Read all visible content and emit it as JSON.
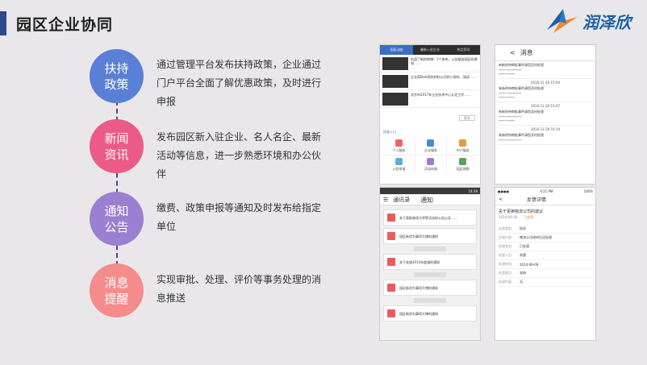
{
  "header": {
    "title": "园区企业协同"
  },
  "logo": {
    "text": "润泽欣",
    "colors": [
      "#1a5fa6",
      "#ec8c2d"
    ]
  },
  "colors": {
    "accent": "#2e4a8c",
    "c1": "#5a7fd6",
    "c2": "#ec5b87",
    "c3": "#9b7fd0",
    "c4": "#f48c8c"
  },
  "features": [
    {
      "title": "扶持\n政策",
      "desc": "通过管理平台发布扶持政策，企业通过门户平台全面了解优惠政策，及时进行申报"
    },
    {
      "title": "新闻\n资讯",
      "desc": "发布园区新入驻企业、名人名企、最新活动等信息，进一步熟悉环境和办公伙伴"
    },
    {
      "title": "通知\n公告",
      "desc": "缴费、政策申报等通知及时发布给指定单位"
    },
    {
      "title": "消息\n提醒",
      "desc": "实现审批、处理、评价等事务处理的消息推送"
    }
  ],
  "screen1": {
    "tabs": [
      "园区动态",
      "最新入驻企业",
      "热点资讯"
    ],
    "news": [
      "巩固了新的商铺！1个来申，公告服务园区的通知……",
      "企业家Bset家的材料公司的二周年，阅读……",
      "北京市2017年企业技术中心认定工作……"
    ],
    "more": "更多",
    "section": "快速入口",
    "grid": [
      "个人服务",
      "企业服务",
      "中介服务",
      "入驻申请",
      "活动申请",
      "园区地图"
    ]
  },
  "screen2": {
    "back": "<",
    "title": "消息",
    "messages": [
      {
        "title": "有新的待审批事件请您及时处理",
        "date": ""
      },
      {
        "title": "有新的待审批事件请您及时处理",
        "date": "2016-11-29 15:00"
      },
      {
        "title": "有新的待审批事件请您及时处理",
        "date": "2016-11-29 14:47"
      },
      {
        "title": "有新的待审批事件请您及时处理",
        "date": "2016-11-29 16:19"
      }
    ]
  },
  "screen3": {
    "status_right": "14:39",
    "title": "通讯录",
    "tab": "通知",
    "notices": [
      "关于表彰继续大师等活动的公告以及……",
      "园区新尚为事项大博的通知",
      "关于发放2014年度通的通知",
      "园区新尚为事项大博的通知",
      "园区新尚为事项大博的通知"
    ]
  },
  "screen4": {
    "status_left": "●●●●",
    "status_mid": "4:21 PM",
    "status_right": "100%",
    "back": "<",
    "title": "反馈详情",
    "fb_title": "关于更换物流公司的建议",
    "fb_date": "2014-09-30",
    "fb_status": "已处理",
    "rows": [
      {
        "k": "反馈类型:",
        "v": "投诉"
      },
      {
        "k": "反馈内容:",
        "v": "物流公司改申后还处理"
      },
      {
        "k": "处理状态:",
        "v": "已处理"
      },
      {
        "k": "处理人员:",
        "v": "宋惠"
      },
      {
        "k": "处理时间:",
        "v": "2014-09-09"
      },
      {
        "k": "处理意见:",
        "v": "采纳"
      },
      {
        "k": "处理内容:",
        "v": "无"
      }
    ]
  }
}
